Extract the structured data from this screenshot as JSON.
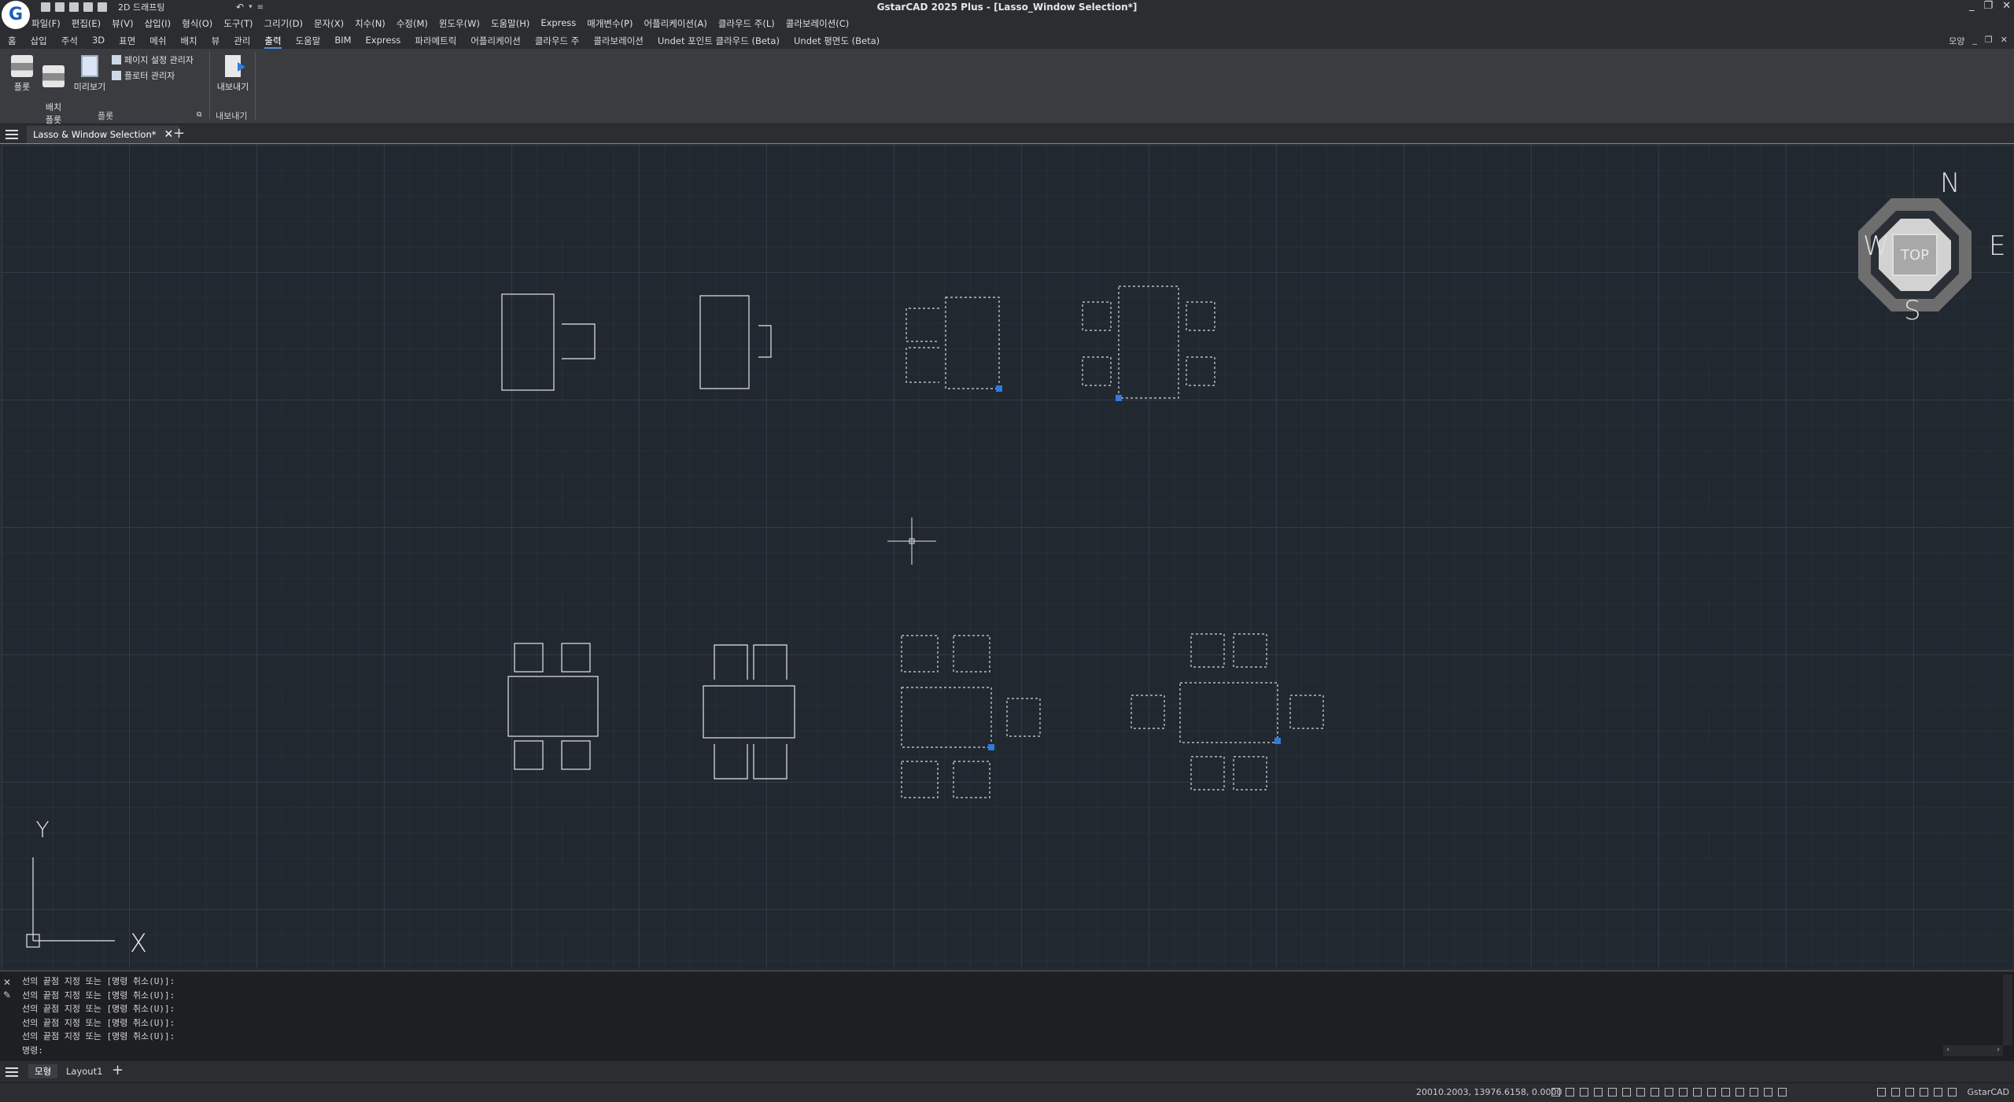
{
  "titlebar": {
    "title": "GstarCAD 2025 Plus - [Lasso_Window Selection*]",
    "workspace": "2D 드래프팅",
    "window_controls": [
      "_",
      "❐",
      "✕"
    ]
  },
  "menubar": [
    "파일(F)",
    "편집(E)",
    "뷰(V)",
    "삽입(I)",
    "형식(O)",
    "도구(T)",
    "그리기(D)",
    "문자(X)",
    "치수(N)",
    "수정(M)",
    "윈도우(W)",
    "도움말(H)",
    "Express",
    "매개변수(P)",
    "어플리케이션(A)",
    "클라우드 주(L)",
    "콜라보레이션(C)"
  ],
  "ribbon_tabs": [
    "홈",
    "삽입",
    "주석",
    "3D",
    "표면",
    "메쉬",
    "배치",
    "뷰",
    "관리",
    "출력",
    "도움말",
    "BIM",
    "Express",
    "파라메트릭",
    "어플리케이션",
    "클라우드 주",
    "콜라보레이션",
    "Undet 포인트 클라우드 (Beta)",
    "Undet 평면도 (Beta)"
  ],
  "active_tab": "출력",
  "tab_right": "모양",
  "ribbon": {
    "plot": "플롯",
    "batch_plot": "배치\n플롯",
    "preview": "미리보기",
    "page_setup": "페이지 설정 관리자",
    "plotter_manager": "플로터 관리자",
    "export": "내보내기",
    "group_plot": "플롯",
    "group_export": "내보내기"
  },
  "document": {
    "tab": "Lasso & Window Selection*"
  },
  "viewcube": {
    "n": "N",
    "s": "S",
    "e": "E",
    "w": "W",
    "top": "TOP"
  },
  "ucs": {
    "x": "X",
    "y": "Y"
  },
  "command": {
    "lines": [
      "선의 끝점 지정 또는 [명령 취소(U)]:",
      "선의 끝점 지정 또는 [명령 취소(U)]:",
      "선의 끝점 지정 또는 [명령 취소(U)]:",
      "선의 끝점 지정 또는 [명령 취소(U)]:",
      "선의 끝점 지정 또는 [명령 취소(U)]:"
    ],
    "prompt": "명령:"
  },
  "layouts": {
    "model": "모형",
    "layout1": "Layout1"
  },
  "status": {
    "coords": "20010.2003, 13976.6158, 0.0000",
    "app": "GstarCAD"
  }
}
